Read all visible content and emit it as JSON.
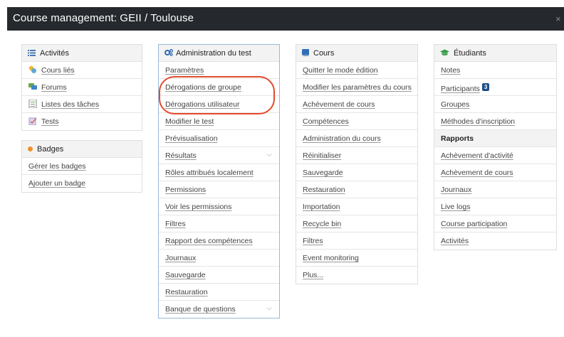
{
  "window": {
    "title": "Course management: GEII / Toulouse",
    "close_glyph": "×"
  },
  "activites": {
    "title": "Activités",
    "items": [
      {
        "label": "Cours liés",
        "icon": "linked-courses-icon"
      },
      {
        "label": "Forums",
        "icon": "forum-icon"
      },
      {
        "label": "Listes des tâches",
        "icon": "task-list-icon"
      },
      {
        "label": "Tests",
        "icon": "quiz-icon"
      }
    ]
  },
  "badges": {
    "title": "Badges",
    "items": [
      "Gérer les badges",
      "Ajouter un badge"
    ]
  },
  "admin_test": {
    "title": "Administration du test",
    "items": [
      "Paramètres",
      "Dérogations de groupe",
      "Dérogations utilisateur",
      "Modifier le test",
      "Prévisualisation",
      "Résultats",
      "Rôles attribués localement",
      "Permissions",
      "Voir les permissions",
      "Filtres",
      "Rapport des compétences",
      "Journaux",
      "Sauvegarde",
      "Restauration",
      "Banque de questions"
    ],
    "chevron_glyph": "⌵"
  },
  "cours": {
    "title": "Cours",
    "items": [
      "Quitter le mode édition",
      "Modifier les paramètres du cours",
      "Achèvement de cours",
      "Compétences",
      "Administration du cours",
      "Réinitialiser",
      "Sauvegarde",
      "Restauration",
      "Importation",
      "Recycle bin",
      "Filtres",
      "Event monitoring",
      "Plus..."
    ]
  },
  "etudiants": {
    "title": "Étudiants",
    "items": [
      "Notes",
      "Participants",
      "Groupes",
      "Méthodes d'inscription"
    ],
    "participants_count": "3",
    "rapports_title": "Rapports",
    "rapports": [
      "Achèvement d'activité",
      "Achèvement de cours",
      "Journaux",
      "Live logs",
      "Course participation",
      "Activités"
    ]
  },
  "colors": {
    "titlebar": "#25292d",
    "highlight": "#e5492c",
    "badge": "#1e4e8c",
    "badge_dot": "#f0902a",
    "active_border": "#9bb8d9"
  }
}
